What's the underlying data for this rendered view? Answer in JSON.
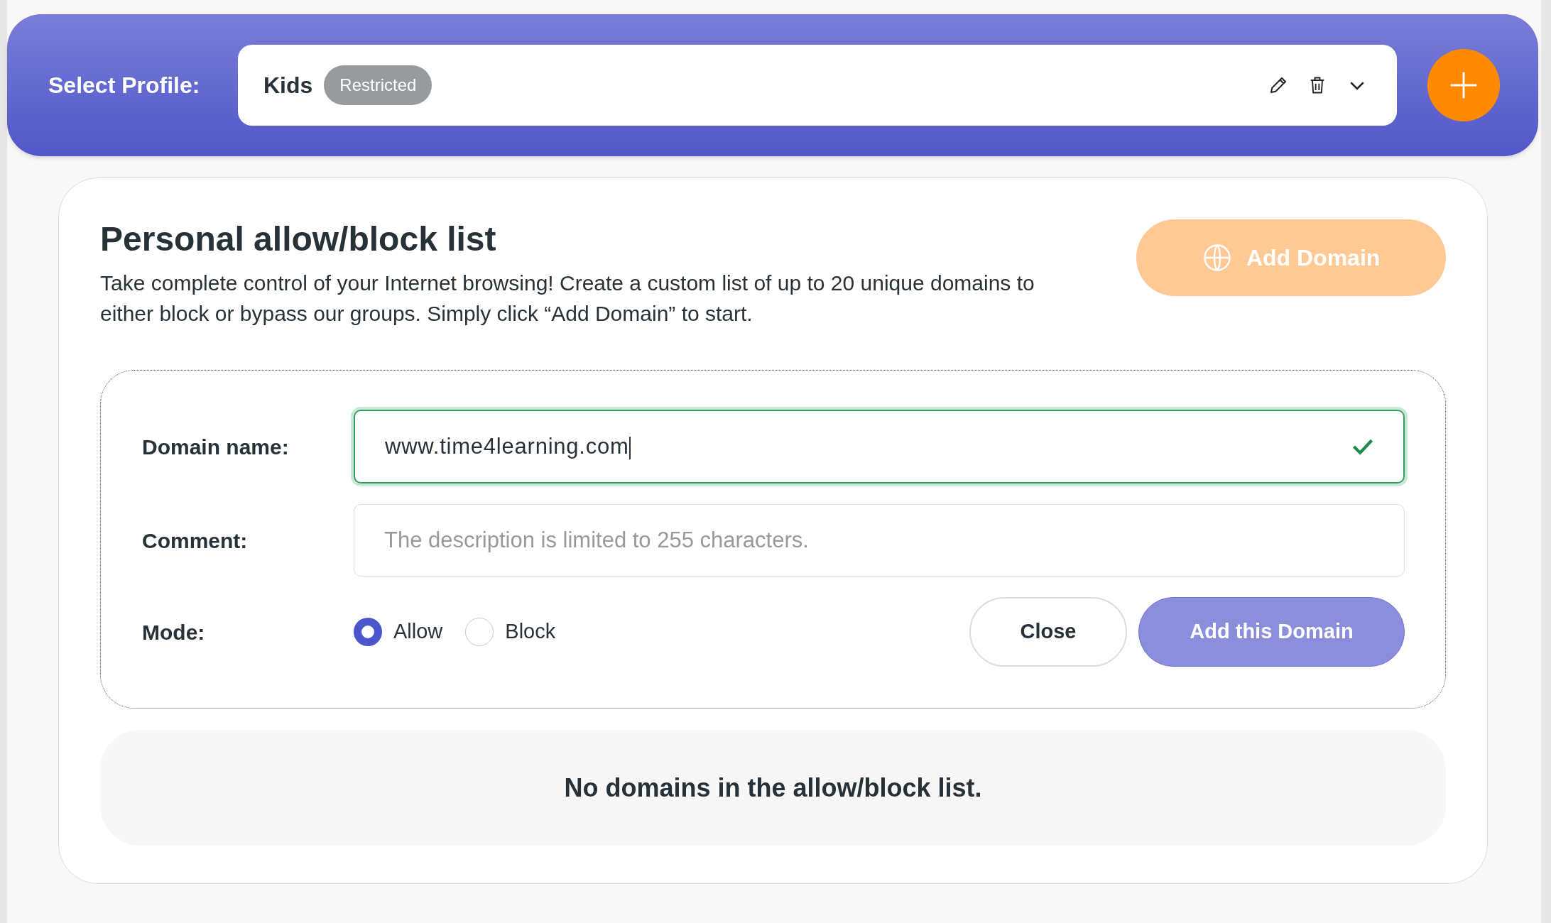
{
  "header": {
    "label": "Select Profile:",
    "profile": {
      "name": "Kids",
      "badge": "Restricted"
    }
  },
  "card": {
    "title": "Personal allow/block list",
    "description": "Take complete control of your Internet browsing! Create a custom list of up to 20 unique domains to either block or bypass our groups. Simply click “Add Domain” to start.",
    "add_button": "Add Domain"
  },
  "form": {
    "domain": {
      "label": "Domain name:",
      "value": "www.time4learning.com",
      "valid": true
    },
    "comment": {
      "label": "Comment:",
      "placeholder": "The description is limited to 255 characters."
    },
    "mode": {
      "label": "Mode:",
      "options": [
        {
          "label": "Allow",
          "selected": true
        },
        {
          "label": "Block",
          "selected": false
        }
      ]
    },
    "buttons": {
      "close": "Close",
      "submit": "Add this Domain"
    }
  },
  "empty_message": "No domains in the allow/block list."
}
